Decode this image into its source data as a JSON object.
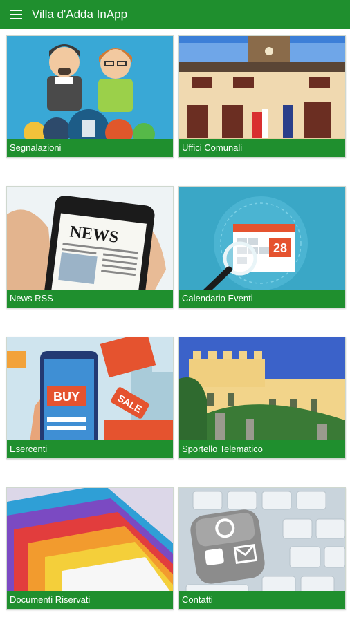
{
  "app": {
    "title": "Villa d'Adda InApp",
    "accent": "#1f8f2e"
  },
  "tiles": [
    {
      "label": "Segnalazioni",
      "icon": "citizens-report-illustration"
    },
    {
      "label": "Uffici Comunali",
      "icon": "town-hall-photo"
    },
    {
      "label": "News RSS",
      "icon": "smartphone-news-photo"
    },
    {
      "label": "Calendario Eventi",
      "icon": "calendar-magnifier-illustration"
    },
    {
      "label": "Esercenti",
      "icon": "shopping-phone-illustration"
    },
    {
      "label": "Sportello Telematico",
      "icon": "villa-castle-photo"
    },
    {
      "label": "Documenti Riservati",
      "icon": "colored-folders-photo"
    },
    {
      "label": "Contatti",
      "icon": "keyboard-contact-cube-photo"
    }
  ],
  "calendar": {
    "day": "28"
  },
  "news": {
    "headline": "NEWS"
  },
  "shop": {
    "buy": "BUY",
    "sale": "SALE"
  }
}
